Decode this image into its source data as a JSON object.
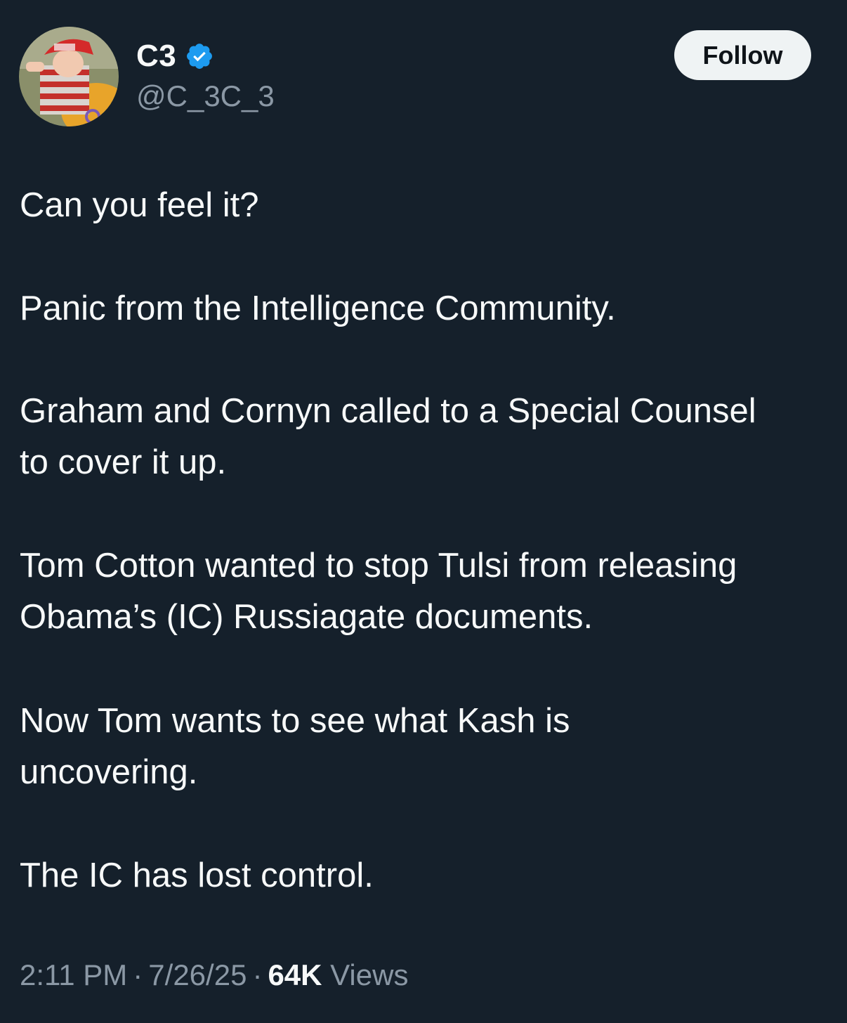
{
  "author": {
    "display_name": "C3",
    "handle": "@C_3C_3",
    "verified_icon": "verified-badge-icon",
    "avatar_icon": "profile-photo"
  },
  "follow_label": "Follow",
  "tweet": {
    "paragraphs": [
      [
        "Can you feel it?"
      ],
      [
        "Panic from the Intelligence Community."
      ],
      [
        "Graham and Cornyn called to a Special Counsel",
        "to cover it up."
      ],
      [
        "Tom Cotton wanted to stop Tulsi from releasing",
        "Obama’s (IC) Russiagate documents."
      ],
      [
        "Now Tom wants to see what Kash is",
        "uncovering."
      ],
      [
        "The IC has lost control."
      ]
    ]
  },
  "meta": {
    "time": "2:11 PM",
    "separator": "·",
    "date": "7/26/25",
    "views_count": "64K",
    "views_label": "Views"
  },
  "colors": {
    "background": "#15202b",
    "text": "#f7f9f9",
    "secondary": "#8b98a5",
    "verified": "#1d9bf0",
    "follow_bg": "#eff3f4"
  }
}
